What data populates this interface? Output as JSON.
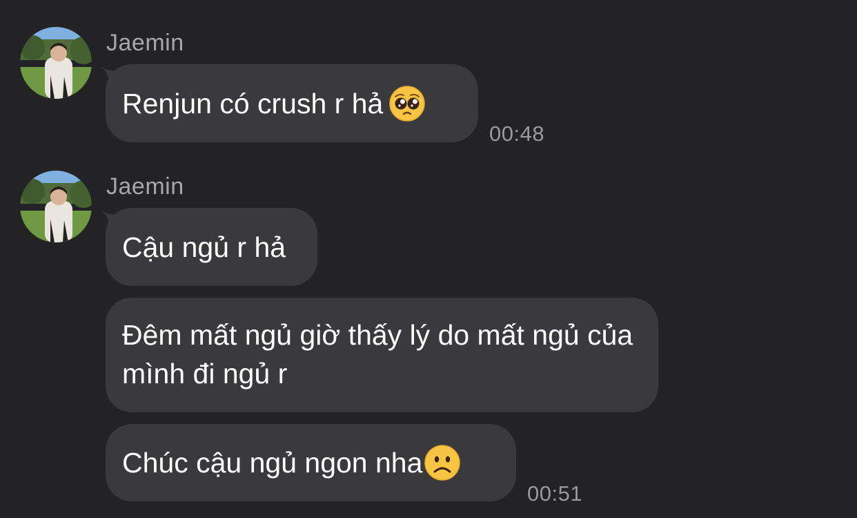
{
  "colors": {
    "background": "#232325",
    "bubble": "#3a3a3c",
    "text": "#ffffff",
    "sender_name": "#a7a7ab",
    "timestamp": "#9a9a9e"
  },
  "groups": [
    {
      "sender": "Jaemin",
      "messages": [
        {
          "text": "Renjun có crush r hả ",
          "emoji": "pleading-face-emoji"
        }
      ],
      "time": "00:48"
    },
    {
      "sender": "Jaemin",
      "messages": [
        {
          "text": "Cậu ngủ r hả"
        },
        {
          "text": "Đêm mất ngủ giờ thấy lý do mất ngủ của mình đi ngủ r"
        },
        {
          "text": "Chúc cậu ngủ ngon nha",
          "emoji": "frowning-face-emoji"
        }
      ],
      "time": "00:51"
    }
  ]
}
